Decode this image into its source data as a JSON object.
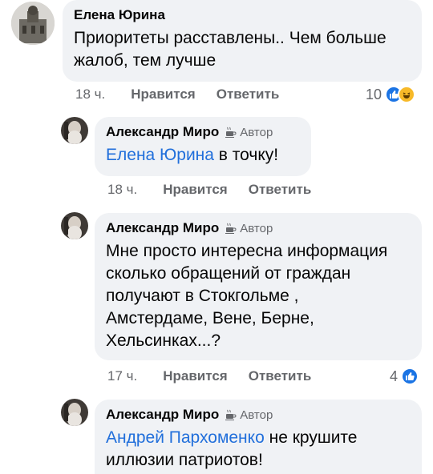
{
  "comments": [
    {
      "author": "Елена Юрина",
      "text": "Приоритеты расставлены.. Чем больше жалоб, тем лучше",
      "time": "18 ч.",
      "like_label": "Нравится",
      "reply_label": "Ответить",
      "reaction_count": "10",
      "reaction_icons": [
        "like-icon",
        "haha-icon"
      ]
    },
    {
      "author": "Александр Миро",
      "badge": "Автор",
      "badge_icon": "coffee-cup-icon",
      "mention": "Елена Юрина",
      "text": " в точку!",
      "time": "18 ч.",
      "like_label": "Нравится",
      "reply_label": "Ответить"
    },
    {
      "author": "Александр Миро",
      "badge": "Автор",
      "badge_icon": "coffee-cup-icon",
      "text": "Мне просто интересна информация сколько обращений от граждан получают в Стокгольме , Амстердаме, Вене, Берне, Хельсинках...?",
      "time": "17 ч.",
      "like_label": "Нравится",
      "reply_label": "Ответить",
      "reaction_count": "4",
      "reaction_icons": [
        "like-icon"
      ]
    },
    {
      "author": "Александр Миро",
      "badge": "Автор",
      "badge_icon": "coffee-cup-icon",
      "mention": "Андрей Пархоменко",
      "text": " не крушите иллюзии патриотов!"
    }
  ],
  "colors": {
    "bubble": "#f0f2f5",
    "mention": "#216fdb",
    "meta": "#65676b",
    "like": "#1b74e4",
    "haha": "#f7b928"
  }
}
